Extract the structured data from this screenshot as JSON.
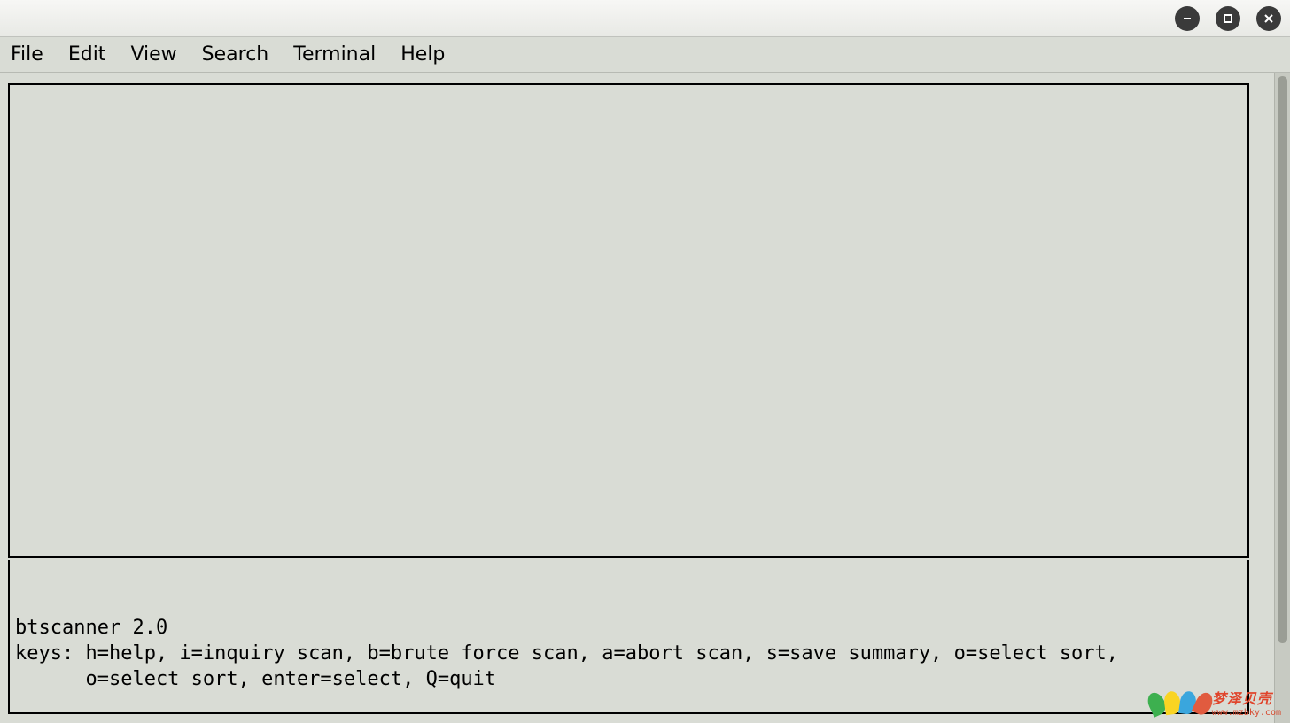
{
  "titlebar": {
    "minimize": "−",
    "maximize": "☐",
    "close": "✕"
  },
  "menubar": {
    "items": [
      "File",
      "Edit",
      "View",
      "Search",
      "Terminal",
      "Help"
    ]
  },
  "terminal": {
    "app_line": "btscanner 2.0",
    "keys_line1": "keys: h=help, i=inquiry scan, b=brute force scan, a=abort scan, s=save summary, o=select sort,",
    "keys_line2": "      o=select sort, enter=select, Q=quit"
  },
  "watermark": {
    "cn": "梦泽贝壳",
    "url": "www.mzbky.com"
  }
}
